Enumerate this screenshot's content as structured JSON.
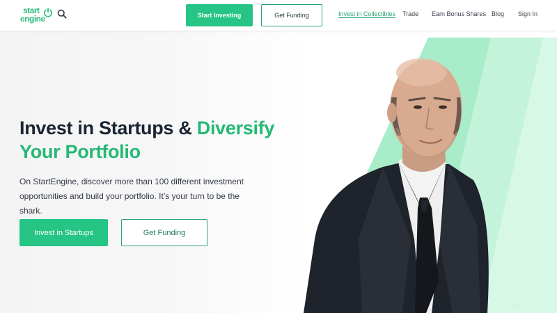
{
  "header": {
    "logo": {
      "line1": "start",
      "line2": "engine"
    },
    "search_icon": "search-icon",
    "start_investing": "Start Investing",
    "get_funding": "Get Funding",
    "nav": [
      {
        "label": "Invest in Collectibles",
        "active": true
      },
      {
        "label": "Trade",
        "active": false
      },
      {
        "label": "Earn Bonus Shares",
        "active": false
      },
      {
        "label": "Blog",
        "active": false
      },
      {
        "label": "Sign In",
        "active": false
      }
    ]
  },
  "hero": {
    "headline_part1": "Invest in Startups & ",
    "headline_accent1": "Diversify",
    "headline_accent2": "Your Portfolio",
    "subtext": "On StartEngine, discover more than 100 different investment opportunities and build your portfolio. It’s your turn to be the shark.",
    "invest_button": "Invest in Startups",
    "funding_button": "Get Funding"
  },
  "colors": {
    "brand_green": "#26c485",
    "mint": "#9de8c4",
    "headline_dark": "#1a2433"
  }
}
